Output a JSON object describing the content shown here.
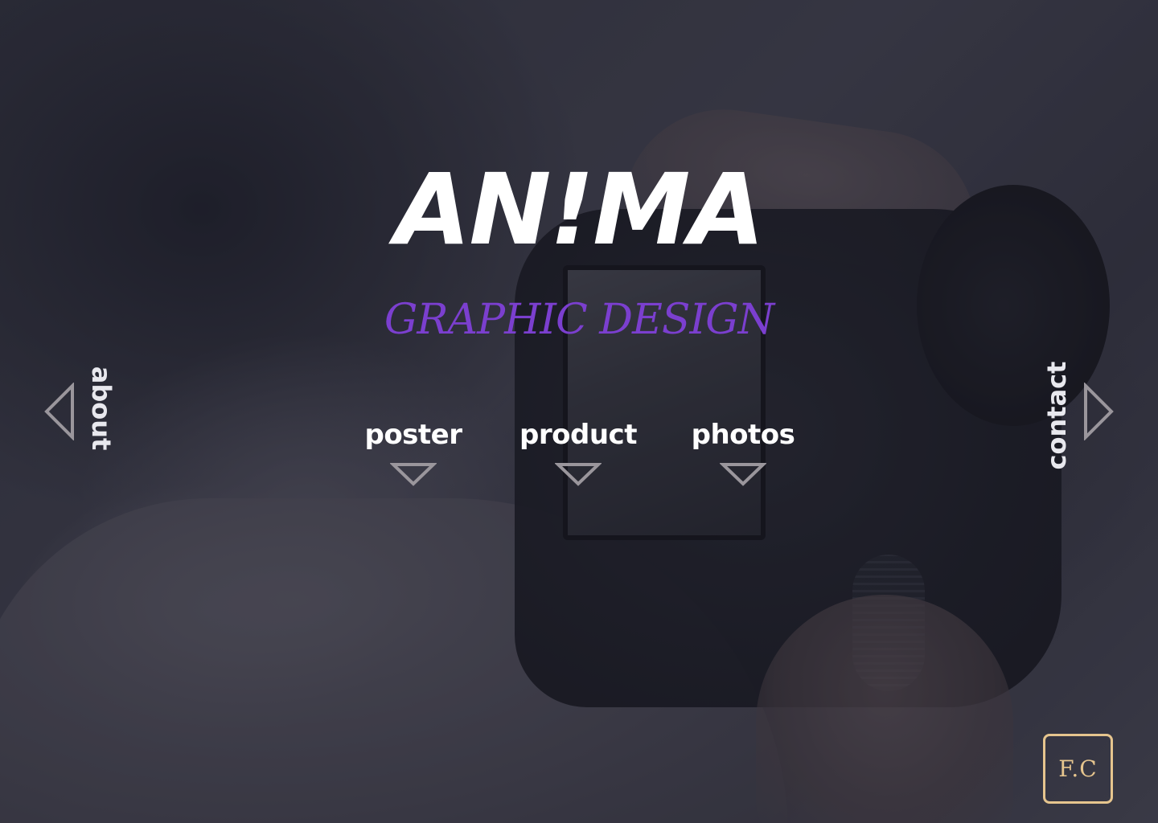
{
  "brand": {
    "logo_text": "AN!MA",
    "tagline": "GRAPHIC DESIGN",
    "tagline_color": "#7b3fcf",
    "monogram": "F.C",
    "monogram_color": "#e6c58e"
  },
  "side_nav": {
    "left": {
      "label": "about",
      "icon": "triangle-left-outline-icon"
    },
    "right": {
      "label": "contact",
      "icon": "triangle-right-outline-icon"
    }
  },
  "categories": [
    {
      "label": "poster",
      "icon": "triangle-down-outline-icon"
    },
    {
      "label": "product",
      "icon": "triangle-down-outline-icon"
    },
    {
      "label": "photos",
      "icon": "triangle-down-outline-icon"
    }
  ],
  "colors": {
    "text": "#ffffff",
    "arrow_stroke": "#9a969c"
  }
}
